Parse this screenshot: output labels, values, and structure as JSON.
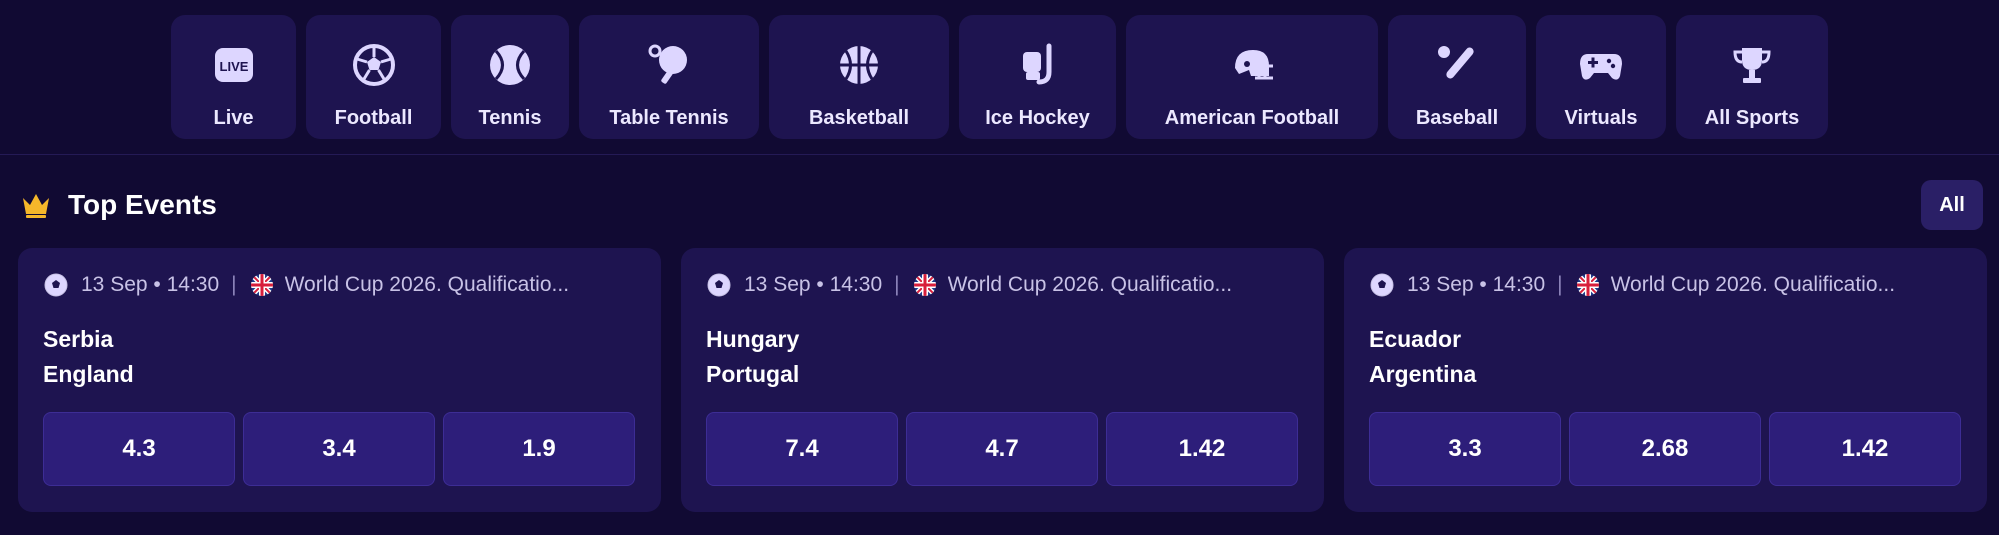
{
  "sports_nav": [
    {
      "label": "Live",
      "icon": "live-icon"
    },
    {
      "label": "Football",
      "icon": "soccer-ball-icon"
    },
    {
      "label": "Tennis",
      "icon": "tennis-ball-icon"
    },
    {
      "label": "Table Tennis",
      "icon": "ping-pong-icon"
    },
    {
      "label": "Basketball",
      "icon": "basketball-icon"
    },
    {
      "label": "Ice Hockey",
      "icon": "hockey-icon"
    },
    {
      "label": "American Football",
      "icon": "helmet-icon"
    },
    {
      "label": "Baseball",
      "icon": "baseball-icon"
    },
    {
      "label": "Virtuals",
      "icon": "gamepad-icon"
    },
    {
      "label": "All Sports",
      "icon": "trophy-icon"
    }
  ],
  "live_badge": "LIVE",
  "top_events": {
    "title": "Top Events",
    "all_label": "All",
    "icon": "crown-icon"
  },
  "events": [
    {
      "date": "13 Sep • 14:30",
      "league": "World Cup 2026. Qualificatio...",
      "home": "Serbia",
      "away": "England",
      "odds": [
        "4.3",
        "3.4",
        "1.9"
      ]
    },
    {
      "date": "13 Sep • 14:30",
      "league": "World Cup 2026. Qualificatio...",
      "home": "Hungary",
      "away": "Portugal",
      "odds": [
        "7.4",
        "4.7",
        "1.42"
      ]
    },
    {
      "date": "13 Sep • 14:30",
      "league": "World Cup 2026. Qualificatio...",
      "home": "Ecuador",
      "away": "Argentina",
      "odds": [
        "3.3",
        "2.68",
        "1.42"
      ]
    }
  ],
  "separator": "|",
  "colors": {
    "background": "#110a33",
    "card": "#1e1450",
    "odd_button": "#2d1e7a",
    "crown": "#f5b72a",
    "icon": "#ddd6ff"
  }
}
